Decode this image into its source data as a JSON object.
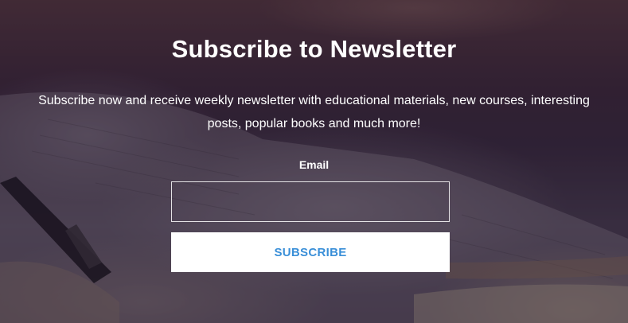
{
  "newsletter": {
    "title": "Subscribe to Newsletter",
    "description": "Subscribe now and receive weekly newsletter with educational materials, new courses, interesting posts, popular books and much more!",
    "email_label": "Email",
    "email_value": "",
    "email_placeholder": "",
    "button_label": "SUBSCRIBE"
  },
  "colors": {
    "button_text": "#3a8fd8",
    "button_background": "#ffffff",
    "text": "#ffffff"
  }
}
